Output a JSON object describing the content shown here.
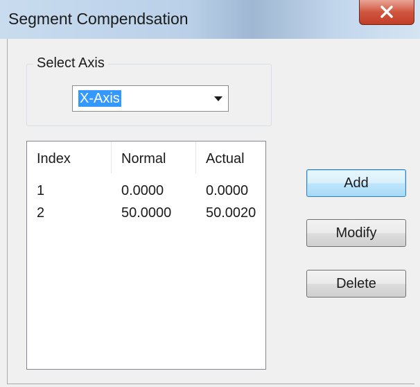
{
  "window": {
    "title": "Segment Compendsation",
    "close_icon": "close-icon"
  },
  "axis_select": {
    "group_label": "Select Axis",
    "selected_value": "X-Axis",
    "dropdown_icon": "chevron-down-icon"
  },
  "table": {
    "columns": [
      "Index",
      "Normal",
      "Actual"
    ],
    "rows": [
      [
        "1",
        "0.0000",
        "0.0000"
      ],
      [
        "2",
        "50.0000",
        "50.0020"
      ]
    ]
  },
  "buttons": {
    "add": "Add",
    "modify": "Modify",
    "delete": "Delete"
  },
  "colors": {
    "selection_highlight": "#3399ff",
    "default_button_border": "#3c7fb1",
    "close_button": "#c23e27"
  }
}
